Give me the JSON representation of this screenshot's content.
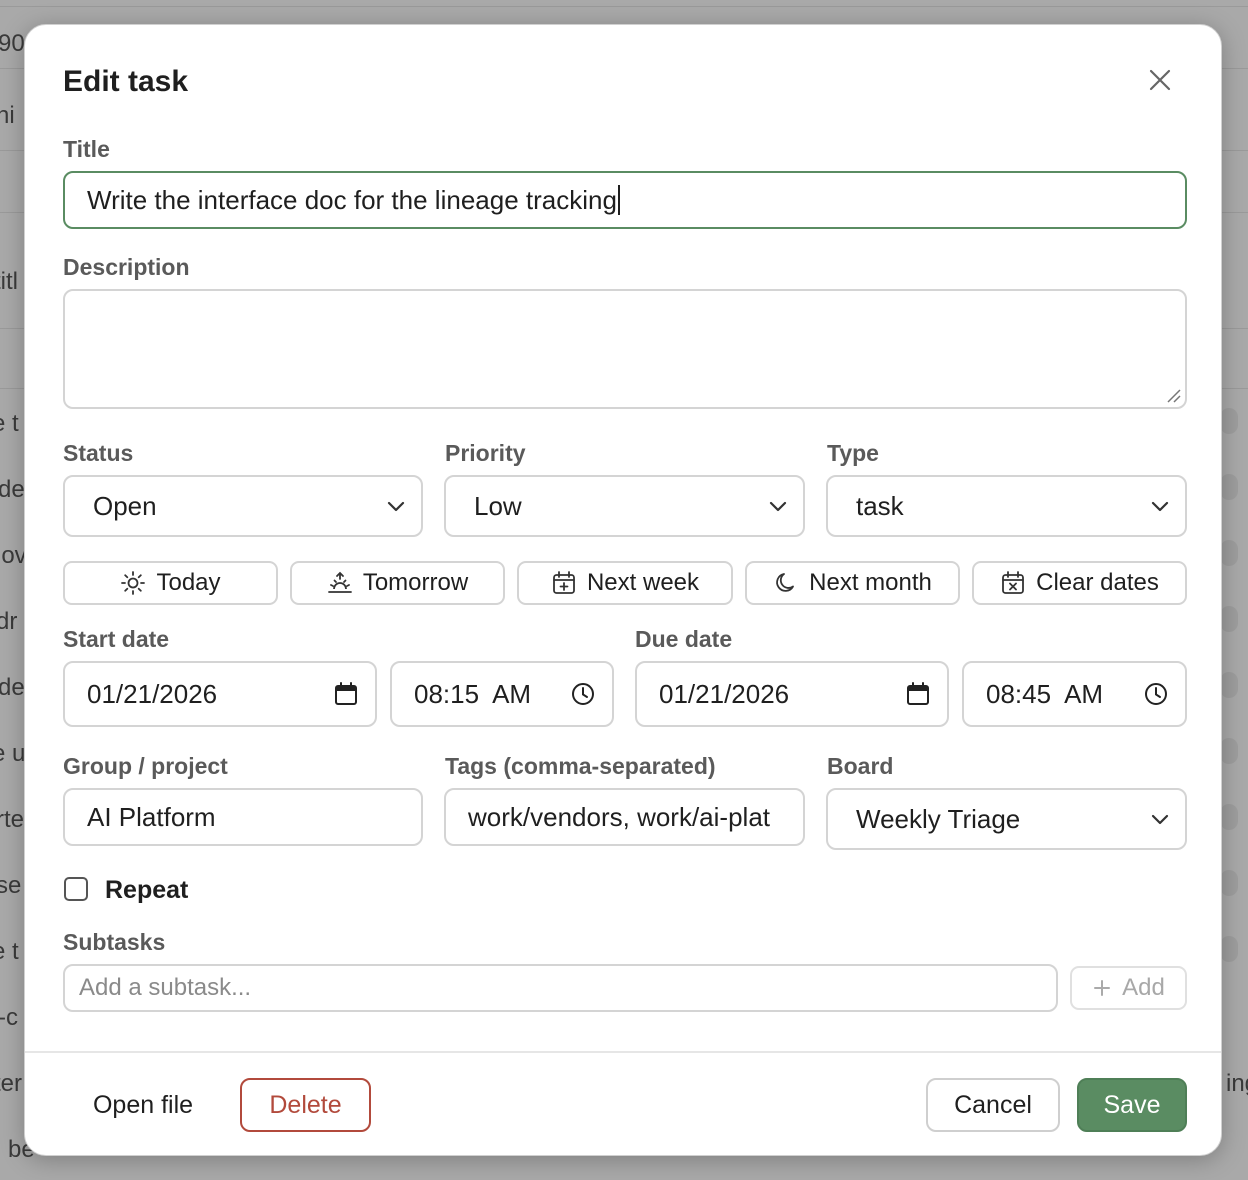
{
  "background": {
    "fragments": [
      "90",
      "hi",
      "titl",
      "e t",
      "de",
      "lov",
      "dr",
      "de",
      "e u",
      "rte",
      "se",
      "e t",
      "-c",
      "ter",
      "be",
      "ing"
    ]
  },
  "modal": {
    "title": "Edit task",
    "title_label": "Title",
    "title_value": "Write the interface doc for the lineage tracking",
    "description_label": "Description",
    "description_value": "",
    "status": {
      "label": "Status",
      "value": "Open"
    },
    "priority": {
      "label": "Priority",
      "value": "Low"
    },
    "type": {
      "label": "Type",
      "value": "task"
    },
    "quick_dates": [
      {
        "label": "Today",
        "icon": "sun-icon"
      },
      {
        "label": "Tomorrow",
        "icon": "sunrise-icon"
      },
      {
        "label": "Next week",
        "icon": "calendar-plus-icon"
      },
      {
        "label": "Next month",
        "icon": "moon-icon"
      },
      {
        "label": "Clear dates",
        "icon": "calendar-x-icon"
      }
    ],
    "start_date": {
      "label": "Start date",
      "date": "01/21/2026",
      "time": "08:15  AM"
    },
    "due_date": {
      "label": "Due date",
      "date": "01/21/2026",
      "time": "08:45  AM"
    },
    "group": {
      "label": "Group / project",
      "value": "AI Platform"
    },
    "tags": {
      "label": "Tags (comma-separated)",
      "value": "work/vendors, work/ai-plat"
    },
    "board": {
      "label": "Board",
      "value": "Weekly Triage"
    },
    "repeat": {
      "label": "Repeat",
      "checked": false
    },
    "subtasks": {
      "label": "Subtasks",
      "placeholder": "Add a subtask...",
      "add_label": "Add"
    },
    "footer": {
      "open_file": "Open file",
      "delete": "Delete",
      "cancel": "Cancel",
      "save": "Save"
    }
  },
  "colors": {
    "accent": "#5a8c62",
    "danger": "#b24a3c",
    "overlay": "#a9a9a9"
  }
}
